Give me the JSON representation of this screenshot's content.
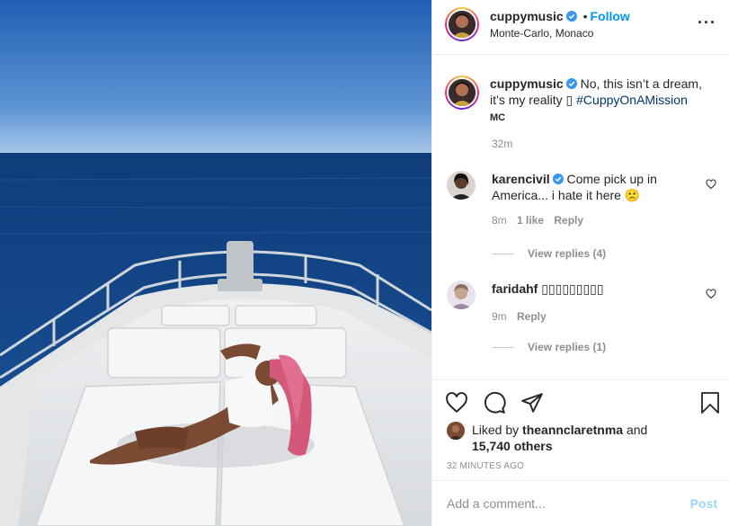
{
  "header": {
    "username": "cuppymusic",
    "separator": "•",
    "follow_label": "Follow",
    "location": "Monte-Carlo, Monaco",
    "more_label": "···"
  },
  "caption": {
    "username": "cuppymusic",
    "text": "No, this isn’t a dream, it’s my reality ▯",
    "hashtag": "#CuppyOnAMission",
    "signature": "MC",
    "time": "32m"
  },
  "comments": [
    {
      "username": "karencivil",
      "text": "Come pick up in America... i hate it here 🙁",
      "time": "8m",
      "likes": "1 like",
      "reply_label": "Reply",
      "view_replies": "View replies (4)"
    },
    {
      "username": "faridahf",
      "text": "▯▯▯▯▯▯▯▯▯",
      "time": "9m",
      "reply_label": "Reply",
      "view_replies": "View replies (1)"
    }
  ],
  "likes": {
    "prefix": "Liked by",
    "user": "theannclaretnma",
    "and": "and",
    "count": "15,740 others"
  },
  "posted_ago": "32 MINUTES AGO",
  "add_comment": {
    "placeholder": "Add a comment...",
    "post_label": "Post"
  },
  "icons": {
    "verified": "verified-badge-icon",
    "like": "heart-icon",
    "comment": "comment-bubble-icon",
    "share": "paper-plane-icon",
    "save": "bookmark-icon",
    "more": "more-dots-icon"
  },
  "colors": {
    "accent": "#0095f6",
    "hashtag": "#00376b",
    "muted": "#8e8e8e",
    "border": "#efefef"
  }
}
